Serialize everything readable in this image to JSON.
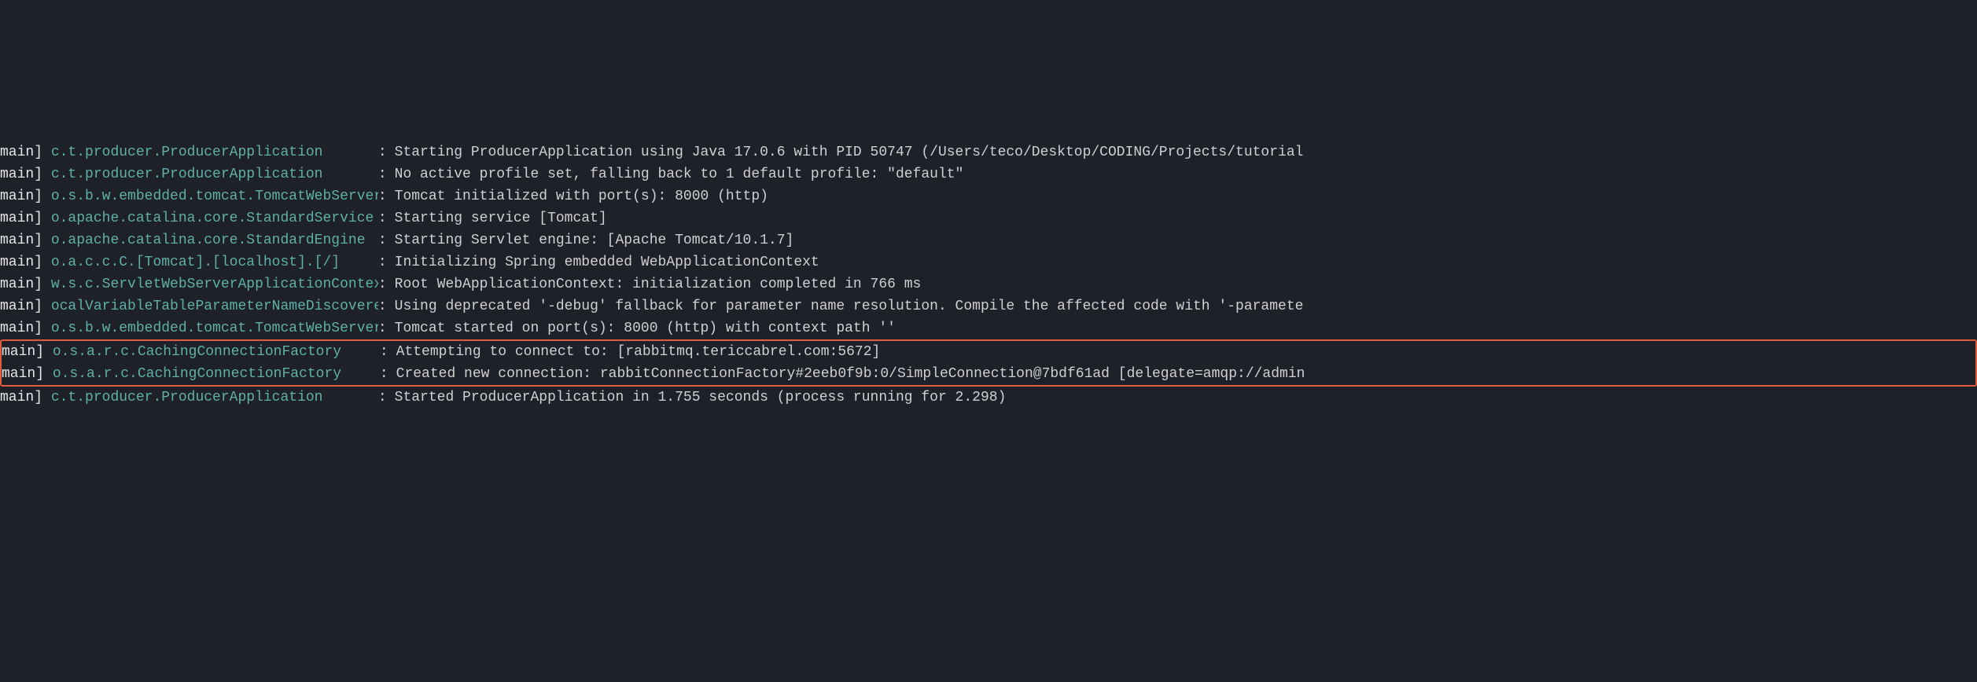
{
  "log": {
    "lines": [
      {
        "thread": "main]",
        "logger": "c.t.producer.ProducerApplication",
        "message": "Starting ProducerApplication using Java 17.0.6 with PID 50747 (/Users/teco/Desktop/CODING/Projects/tutorial"
      },
      {
        "thread": "main]",
        "logger": "c.t.producer.ProducerApplication",
        "message": "No active profile set, falling back to 1 default profile: \"default\""
      },
      {
        "thread": "main]",
        "logger": "o.s.b.w.embedded.tomcat.TomcatWebServer",
        "message": "Tomcat initialized with port(s): 8000 (http)"
      },
      {
        "thread": "main]",
        "logger": "o.apache.catalina.core.StandardService",
        "message": "Starting service [Tomcat]"
      },
      {
        "thread": "main]",
        "logger": "o.apache.catalina.core.StandardEngine",
        "message": "Starting Servlet engine: [Apache Tomcat/10.1.7]"
      },
      {
        "thread": "main]",
        "logger": "o.a.c.c.C.[Tomcat].[localhost].[/]",
        "message": "Initializing Spring embedded WebApplicationContext"
      },
      {
        "thread": "main]",
        "logger": "w.s.c.ServletWebServerApplicationContext",
        "message": "Root WebApplicationContext: initialization completed in 766 ms"
      },
      {
        "thread": "main]",
        "logger": "ocalVariableTableParameterNameDiscoverer",
        "message": "Using deprecated '-debug' fallback for parameter name resolution. Compile the affected code with '-paramete"
      },
      {
        "thread": "main]",
        "logger": "o.s.b.w.embedded.tomcat.TomcatWebServer",
        "message": "Tomcat started on port(s): 8000 (http) with context path ''"
      },
      {
        "thread": "main]",
        "logger": "o.s.a.r.c.CachingConnectionFactory",
        "message": "Attempting to connect to: [rabbitmq.tericcabrel.com:5672]"
      },
      {
        "thread": "main]",
        "logger": "o.s.a.r.c.CachingConnectionFactory",
        "message": "Created new connection: rabbitConnectionFactory#2eeb0f9b:0/SimpleConnection@7bdf61ad [delegate=amqp://admin"
      },
      {
        "thread": "main]",
        "logger": "c.t.producer.ProducerApplication",
        "message": "Started ProducerApplication in 1.755 seconds (process running for 2.298)"
      }
    ],
    "highlighted_indices": [
      9,
      10
    ]
  }
}
